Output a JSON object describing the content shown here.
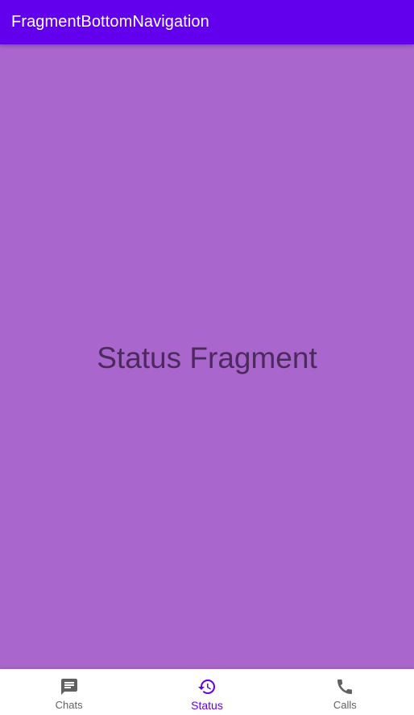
{
  "app_bar": {
    "title": "FragmentBottomNavigation"
  },
  "main": {
    "fragment_label": "Status Fragment"
  },
  "bottom_nav": {
    "items": [
      {
        "label": "Chats",
        "icon": "chat-icon",
        "active": false
      },
      {
        "label": "Status",
        "icon": "history-icon",
        "active": true
      },
      {
        "label": "Calls",
        "icon": "phone-icon",
        "active": false
      }
    ]
  },
  "colors": {
    "primary": "#6200ee",
    "content_background": "#a966cd",
    "fragment_text": "#4d2a5e",
    "inactive_nav": "#616161",
    "nav_background": "#ffffff"
  }
}
